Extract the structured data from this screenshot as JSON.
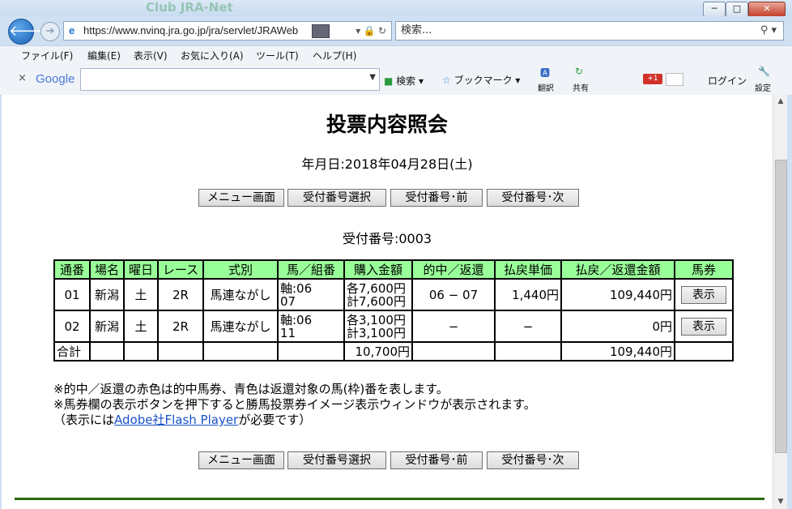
{
  "window": {
    "ghost_title": "Club JRA-Net",
    "minimize": "─",
    "maximize": "□",
    "close": "✕"
  },
  "address": {
    "url": "https://www.nvinq.jra.go.jp/jra/servlet/JRAWeb",
    "search_placeholder": "検索..."
  },
  "menu": [
    "ファイル(F)",
    "編集(E)",
    "表示(V)",
    "お気に入り(A)",
    "ツール(T)",
    "ヘルプ(H)"
  ],
  "googlebar": {
    "logo": "Google",
    "search_label": "検索",
    "bookmark_label": "ブックマーク",
    "translate_label": "翻訳",
    "share_label": "共有",
    "gplus": "+1",
    "login_label": "ログイン",
    "settings_label": "設定"
  },
  "page": {
    "title": "投票内容照会",
    "date_line": "年月日:2018年04月28日(土)",
    "receipt_line": "受付番号:0003",
    "nav_buttons": [
      "メニュー画面",
      "受付番号選択",
      "受付番号･前",
      "受付番号･次"
    ]
  },
  "table": {
    "headers": [
      "通番",
      "場名",
      "曜日",
      "レース",
      "式別",
      "馬／組番",
      "購入金額",
      "的中／返還",
      "払戻単価",
      "払戻／返還金額",
      "馬券"
    ],
    "rows": [
      {
        "no": "01",
        "venue": "新潟",
        "day": "土",
        "race": "2R",
        "type": "馬連ながし",
        "combo1": "軸:06",
        "combo2": "07",
        "amt1": "各7,600円",
        "amt2": "計7,600円",
        "hit": "06 − 07",
        "unit": "1,440円",
        "payout": "109,440円",
        "ticket": "表示"
      },
      {
        "no": "02",
        "venue": "新潟",
        "day": "土",
        "race": "2R",
        "type": "馬連ながし",
        "combo1": "軸:06",
        "combo2": "11",
        "amt1": "各3,100円",
        "amt2": "計3,100円",
        "hit": "−",
        "unit": "−",
        "payout": "0円",
        "ticket": "表示"
      }
    ],
    "total": {
      "label": "合計",
      "amount": "10,700円",
      "payout": "109,440円"
    }
  },
  "notes": {
    "line1": "※的中／返還の赤色は的中馬券、青色は返還対象の馬(枠)番を表します。",
    "line2": "※馬券欄の表示ボタンを押下すると勝馬投票券イメージ表示ウィンドウが表示されます。",
    "line3_pre": "（表示には",
    "line3_link": "Adobe社Flash Player",
    "line3_post": "が必要です）"
  },
  "colors": {
    "header_bg": "#99ff99",
    "hit_red": "#e01010",
    "link": "#1a52c8",
    "footer_line": "#2b6b14"
  }
}
